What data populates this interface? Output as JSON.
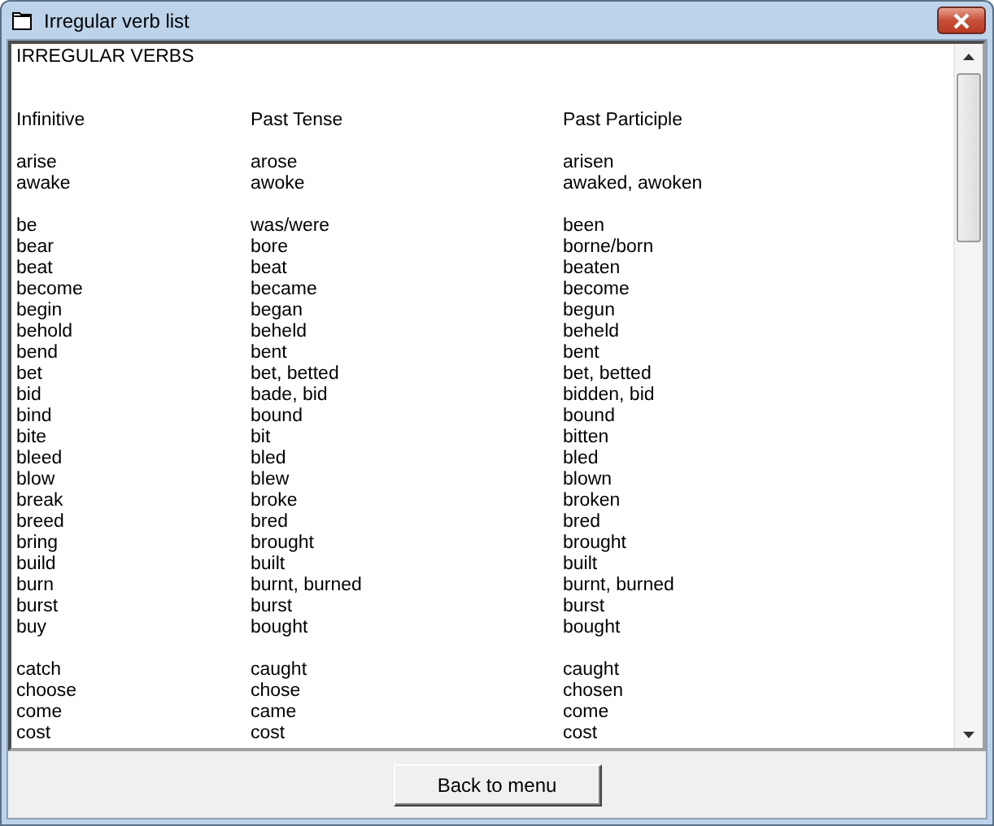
{
  "window": {
    "title": "Irregular verb list"
  },
  "document": {
    "heading": "IRREGULAR VERBS",
    "columns": [
      "Infinitive",
      "Past Tense",
      "Past Participle"
    ],
    "groups": [
      {
        "rows": [
          [
            "arise",
            "arose",
            "arisen"
          ],
          [
            "awake",
            "awoke",
            "awaked, awoken"
          ]
        ]
      },
      {
        "rows": [
          [
            "be",
            "was/were",
            "been"
          ],
          [
            "bear",
            "bore",
            "borne/born"
          ],
          [
            "beat",
            "beat",
            "beaten"
          ],
          [
            "become",
            "became",
            "become"
          ],
          [
            "begin",
            "began",
            "begun"
          ],
          [
            "behold",
            "beheld",
            "beheld"
          ],
          [
            "bend",
            "bent",
            "bent"
          ],
          [
            "bet",
            "bet, betted",
            "bet, betted"
          ],
          [
            "bid",
            "bade, bid",
            "bidden, bid"
          ],
          [
            "bind",
            "bound",
            "bound"
          ],
          [
            "bite",
            "bit",
            "bitten"
          ],
          [
            "bleed",
            "bled",
            "bled"
          ],
          [
            "blow",
            "blew",
            "blown"
          ],
          [
            "break",
            "broke",
            "broken"
          ],
          [
            "breed",
            "bred",
            "bred"
          ],
          [
            "bring",
            "brought",
            "brought"
          ],
          [
            "build",
            "built",
            "built"
          ],
          [
            "burn",
            "burnt, burned",
            "burnt, burned"
          ],
          [
            "burst",
            "burst",
            "burst"
          ],
          [
            "buy",
            "bought",
            "bought"
          ]
        ]
      },
      {
        "rows": [
          [
            "catch",
            "caught",
            "caught"
          ],
          [
            "choose",
            "chose",
            "chosen"
          ],
          [
            "come",
            "came",
            "come"
          ],
          [
            "cost",
            "cost",
            "cost"
          ]
        ]
      }
    ]
  },
  "buttons": [
    {
      "label": "Back to menu"
    }
  ]
}
